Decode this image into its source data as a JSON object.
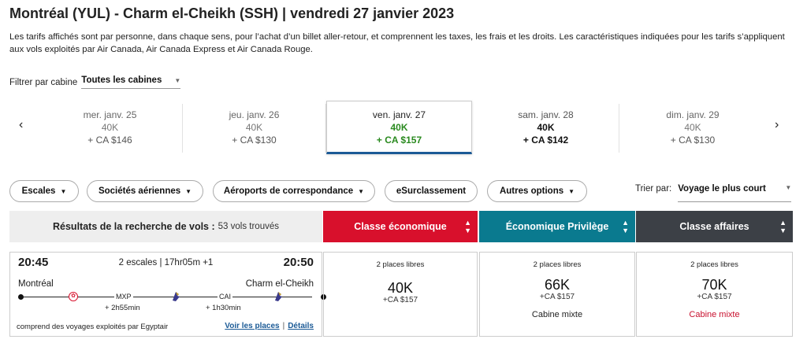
{
  "header": {
    "title": "Montréal (YUL) - Charm el-Cheikh (SSH)  |  vendredi 27 janvier 2023",
    "description": "Les tarifs affichés sont par personne, dans chaque sens, pour l’achat d’un billet aller-retour, et comprennent les taxes, les frais et les droits. Les caractéristiques indiquées pour les tarifs s’appliquent aux vols exploités par Air Canada, Air Canada Express et Air Canada Rouge."
  },
  "cabin_filter": {
    "label": "Filtrer par cabine",
    "value": "Toutes les cabines"
  },
  "dates": [
    {
      "date": "mer. janv. 25",
      "points": "40K",
      "cash": "+ CA $146"
    },
    {
      "date": "jeu. janv. 26",
      "points": "40K",
      "cash": "+ CA $130"
    },
    {
      "date": "ven. janv. 27",
      "points": "40K",
      "cash": "+ CA $157"
    },
    {
      "date": "sam. janv. 28",
      "points": "40K",
      "cash": "+ CA $142"
    },
    {
      "date": "dim. janv. 29",
      "points": "40K",
      "cash": "+ CA $130"
    }
  ],
  "filters": {
    "stops": "Escales",
    "airlines": "Sociétés aériennes",
    "connecting": "Aéroports de correspondance",
    "upgrade": "eSurclassement",
    "more": "Autres options"
  },
  "sort": {
    "label": "Trier par:",
    "value": "Voyage le plus court"
  },
  "results": {
    "label": "Résultats de la recherche de vols :",
    "count": "53 vols trouvés"
  },
  "cabins": {
    "economy": "Classe économique",
    "premium": "Économique Privilège",
    "business": "Classe affaires"
  },
  "flight": {
    "depart_time": "20:45",
    "arrive_time": "20:50",
    "summary": "2 escales | 17hr05m +1",
    "origin": "Montréal",
    "destination": "Charm el-Cheikh",
    "stop1": "MXP",
    "layover1": "+ 2h55min",
    "stop2": "CAI",
    "layover2": "+ 1h30min",
    "operated_by": "comprend des voyages exploités par Egyptair",
    "seats_link": "Voir les places",
    "separator": "|",
    "details_link": "Détails"
  },
  "fares": [
    {
      "seats": "2 places libres",
      "points": "40K",
      "cash": "+CA $157",
      "note": ""
    },
    {
      "seats": "2 places libres",
      "points": "66K",
      "cash": "+CA $157",
      "note": "Cabine mixte"
    },
    {
      "seats": "2 places libres",
      "points": "70K",
      "cash": "+CA $157",
      "note": "Cabine mixte"
    }
  ],
  "icons": {
    "prev": "chevron-left-icon",
    "next": "chevron-right-icon",
    "dropdown": "chevron-down-icon",
    "sort": "sort-arrows-icon",
    "air_canada": "air-canada-logo-icon",
    "egyptair": "egyptair-logo-icon"
  },
  "colors": {
    "economy": "#d8102c",
    "premium": "#0a7a8f",
    "business": "#3c4046",
    "selected_price": "#2a8a1f",
    "link": "#1b5a96"
  }
}
